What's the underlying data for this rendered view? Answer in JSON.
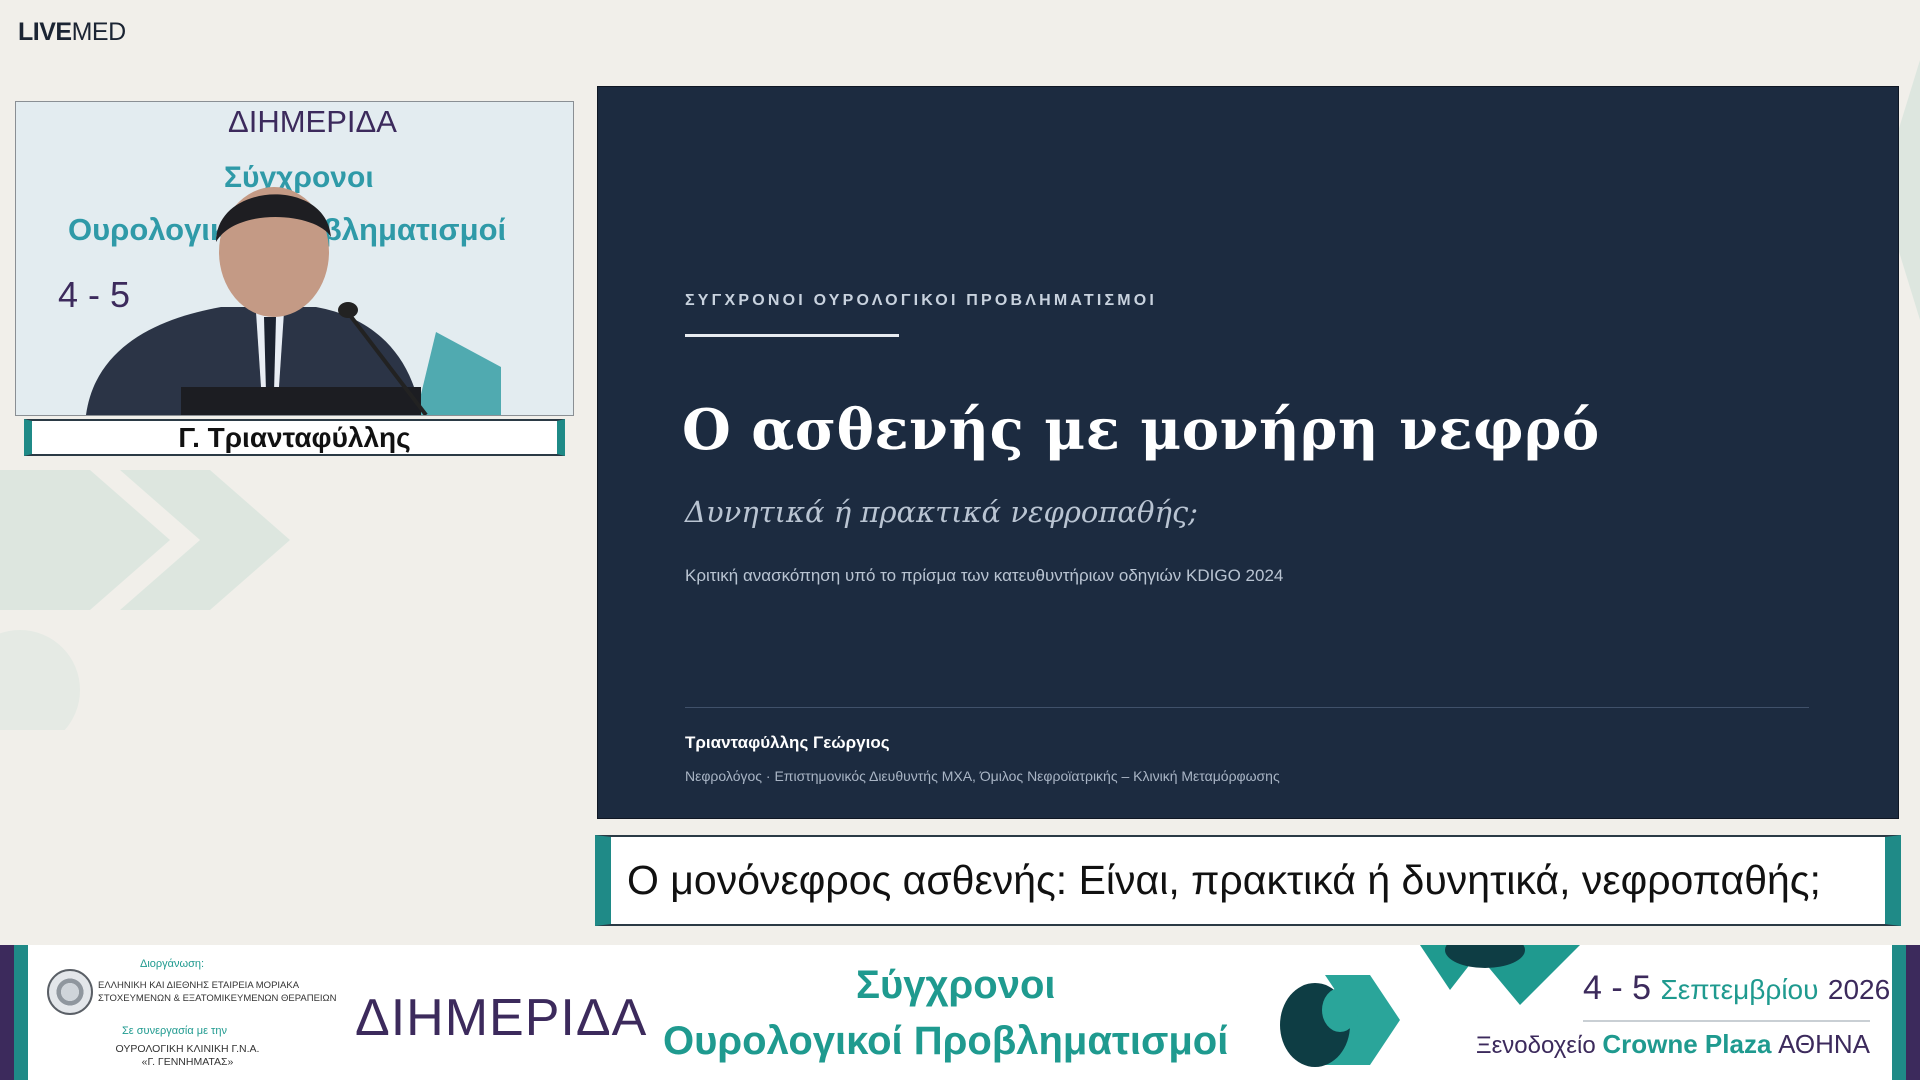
{
  "brand": {
    "logo_bold": "LIVE",
    "logo_light": "MED"
  },
  "speaker": {
    "name": "Γ. Τριανταφύλλης"
  },
  "video_backdrop": {
    "line1": "ΔΙΗΜΕΡΙΔΑ",
    "line2": "Σύγχρονοι",
    "line3": "Ουρολογικοί Προβληματισμοί",
    "line4": "4 - 5"
  },
  "slide": {
    "kicker": "ΣΥΓΧΡΟΝΟΙ ΟΥΡΟΛΟΓΙΚΟΙ ΠΡΟΒΛΗΜΑΤΙΣΜΟΙ",
    "title": "Ο ασθενής με μονήρη νεφρό",
    "subtitle": "Δυνητικά ή πρακτικά νεφροπαθής;",
    "description": "Κριτική ανασκόπηση υπό το πρίσμα των κατευθυντήριων οδηγιών KDIGO 2024",
    "author": "Τριανταφύλλης Γεώργιος",
    "role": "Νεφρολόγος · Επιστημονικός Διευθυντής ΜΧΑ, Όμιλος Νεφροϊατρικής – Κλινική Μεταμόρφωσης"
  },
  "caption": {
    "text": "Ο μονόνεφρος ασθενής: Είναι, πρακτικά ή δυνητικά, νεφροπαθής;"
  },
  "footer": {
    "org_label": "Διοργάνωση:",
    "org_name_1": "ΕΛΛΗΝΙΚΗ ΚΑΙ ΔΙΕΘΝΗΣ ΕΤΑΙΡΕΙΑ ΜΟΡΙΑΚΑ",
    "org_name_2": "ΣΤΟΧΕΥΜΕΝΩΝ & ΕΞΑΤΟΜΙΚΕΥΜΕΝΩΝ ΘΕΡΑΠΕΙΩΝ",
    "collab_label": "Σε συνεργασία με την",
    "clinic_1": "ΟΥΡΟΛΟΓΙΚΗ ΚΛΙΝΙΚΗ Γ.Ν.Α.",
    "clinic_2": "«Γ. ΓΕΝΝΗΜΑΤΑΣ»",
    "event_type": "ΔΙΗΜΕΡΙΔΑ",
    "event_title_1": "Σύγχρονοι",
    "event_title_2": "Ουρολογικοί Προβληματισμοί",
    "date_days": "4 - 5",
    "date_month": "Σεπτεμβρίου",
    "date_year": "2026",
    "venue_prefix": "Ξενοδοχείο",
    "venue_hotel": "Crowne Plaza",
    "venue_city": "ΑΘΗΝΑ"
  },
  "colors": {
    "teal": "#1f9a8f",
    "purple": "#3c2a5c",
    "slide_bg": "#1c2b40",
    "page_bg": "#f1efea"
  }
}
